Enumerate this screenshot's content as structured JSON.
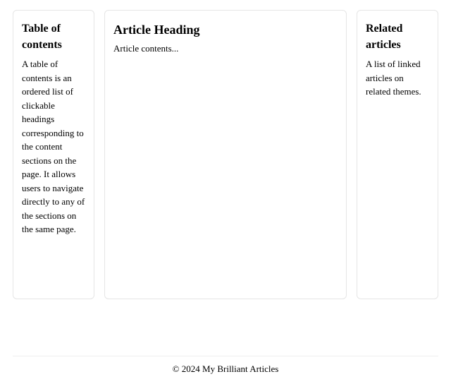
{
  "toc": {
    "heading": "Table of contents",
    "body": "A table of contents is an ordered list of clickable headings corresponding to the content sections on the page. It allows users to navigate directly to any of the sections on the same page."
  },
  "article": {
    "heading": "Article Heading",
    "body": "Article contents..."
  },
  "related": {
    "heading": "Related articles",
    "body": "A list of linked articles on related themes."
  },
  "footer": {
    "text": "© 2024 My Brilliant Articles"
  }
}
